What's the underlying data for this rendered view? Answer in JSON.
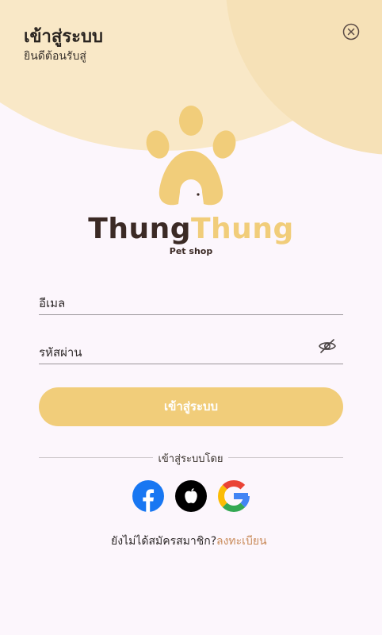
{
  "header": {
    "title": "เข้าสู่ระบบ",
    "subtitle": "ยินดีต้อนรับสู่"
  },
  "brand": {
    "name_part1": "Thung",
    "name_part2": "Thung",
    "tagline": "Pet shop"
  },
  "form": {
    "email_label": "อีเมล",
    "password_label": "รหัสผ่าน",
    "login_button": "เข้าสู่ระบบ"
  },
  "social": {
    "divider_text": "เข้าสู่ระบบโดย",
    "providers": [
      "facebook",
      "apple",
      "google"
    ]
  },
  "footer": {
    "question": "ยังไม่ได้สมัครสมาชิก?",
    "register_link": "ลงทะเบียน"
  },
  "colors": {
    "accent": "#f1cd7a",
    "brand_dark": "#3b2a25",
    "link": "#c98b5a",
    "background": "#fcf6fc"
  },
  "icons": {
    "close": "close-icon",
    "password_toggle": "eye-off-icon",
    "logo": "paw-icon"
  }
}
